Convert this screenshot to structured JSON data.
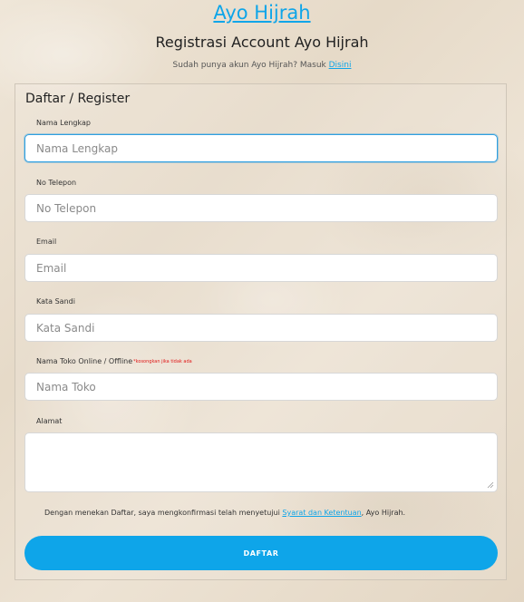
{
  "header": {
    "brand": "Ayo Hijrah",
    "title": "Registrasi Account Ayo Hijrah",
    "login_prompt": "Sudah punya akun Ayo Hijrah? Masuk",
    "login_link": "Disini"
  },
  "form": {
    "title": "Daftar / Register",
    "fields": [
      {
        "label": "Nama Lengkap",
        "placeholder": "Nama Lengkap",
        "value": ""
      },
      {
        "label": "No Telepon",
        "placeholder": "No Telepon",
        "value": ""
      },
      {
        "label": "Email",
        "placeholder": "Email",
        "value": ""
      },
      {
        "label": "Kata Sandi",
        "placeholder": "Kata Sandi",
        "value": ""
      },
      {
        "label": "Nama Toko Online / Offline",
        "hint": "*kosongkan jika tidak ada",
        "placeholder": "Nama Toko",
        "value": ""
      }
    ],
    "address": {
      "label": "Alamat",
      "value": ""
    },
    "consent": {
      "prefix": "Dengan menekan Daftar, saya mengkonfirmasi telah menyetujui",
      "link": "Syarat dan Ketentuan",
      "suffix": ", Ayo Hijrah."
    },
    "submit_label": "DAFTAR"
  },
  "colors": {
    "accent": "#0ea5e9",
    "hint": "#e01818",
    "focus_border": "#2f9fe0"
  }
}
